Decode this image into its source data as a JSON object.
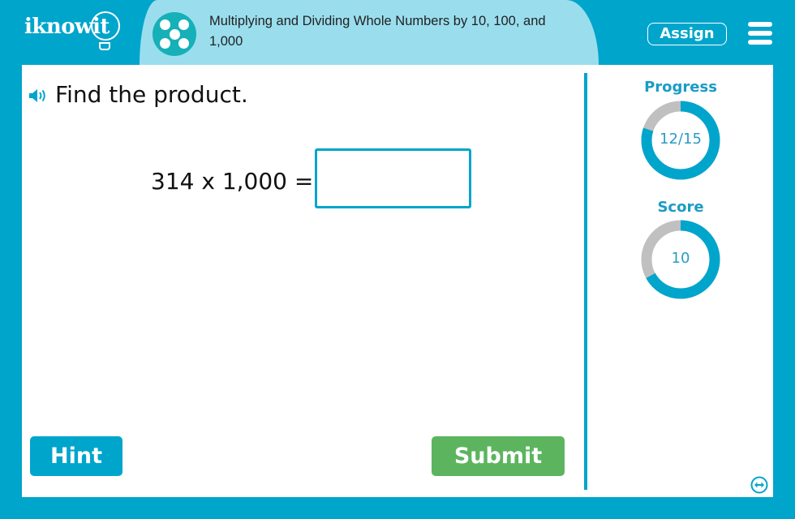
{
  "header": {
    "logo_text": "iknowit",
    "lesson_title": "Multiplying and Dividing Whole Numbers by 10, 100, and 1,000",
    "assign_label": "Assign",
    "menu_icon": "hamburger-menu-icon",
    "lesson_icon": "dice-five-icon"
  },
  "question": {
    "prompt": "Find the product.",
    "equation": "314 x 1,000 =",
    "answer_value": "",
    "answer_placeholder": "",
    "audio_icon": "speaker-icon"
  },
  "buttons": {
    "hint_label": "Hint",
    "submit_label": "Submit"
  },
  "sidebar": {
    "progress": {
      "label": "Progress",
      "text": "12/15",
      "current": 12,
      "total": 15
    },
    "score": {
      "label": "Score",
      "text": "10",
      "fraction": 0.67
    },
    "expand_icon": "expand-arrows-icon"
  },
  "colors": {
    "brand": "#00a5cc",
    "title_pill": "#9adeee",
    "lesson_icon": "#16b0b8",
    "submit": "#5cb55e",
    "ring_track": "#c0c0c0"
  }
}
